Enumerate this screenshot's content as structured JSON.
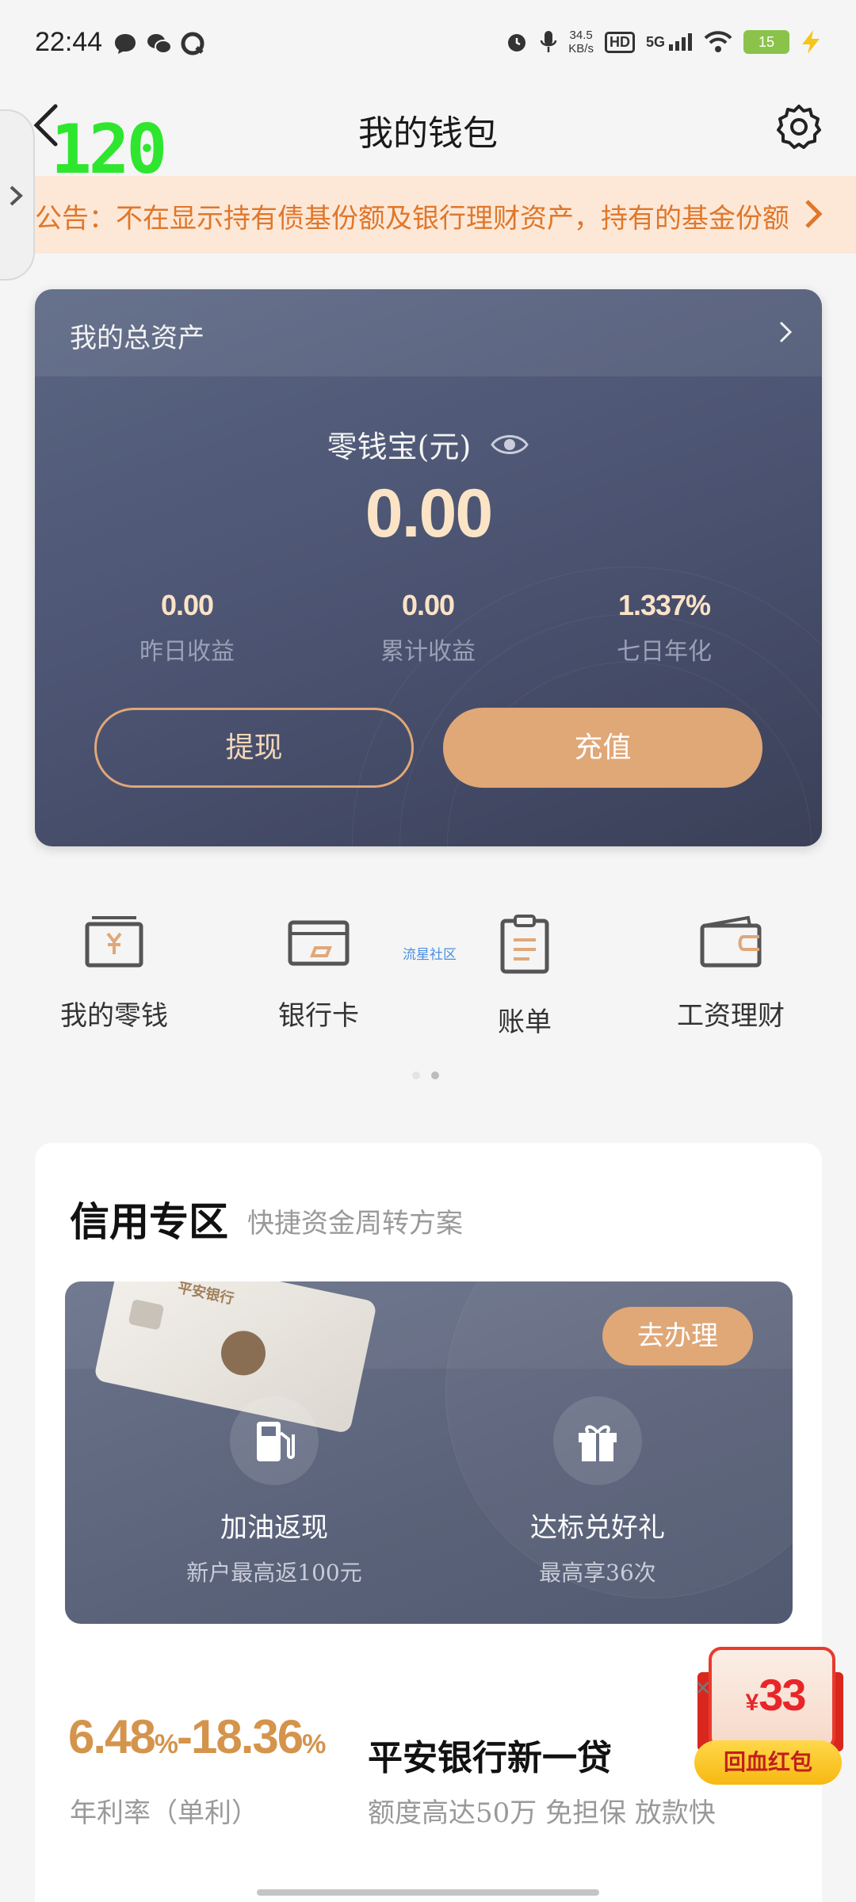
{
  "status_bar": {
    "time": "22:44",
    "net_speed_value": "34.5",
    "net_speed_unit": "KB/s",
    "hd_label": "HD",
    "network_label": "5G",
    "battery_level": "15"
  },
  "header": {
    "title": "我的钱包",
    "fps_counter": "120"
  },
  "notice": {
    "text": "公告：不在显示持有债基份额及银行理财资产，持有的基金份额:"
  },
  "assets": {
    "title": "我的总资产",
    "balance_label": "零钱宝(元)",
    "balance_value": "0.00",
    "stats": [
      {
        "value": "0.00",
        "label": "昨日收益"
      },
      {
        "value": "0.00",
        "label": "累计收益"
      },
      {
        "value": "1.337%",
        "label": "七日年化"
      }
    ],
    "withdraw_label": "提现",
    "recharge_label": "充值"
  },
  "shortcuts": {
    "items": [
      {
        "label": "我的零钱",
        "icon": "yuan-wallet-icon"
      },
      {
        "label": "银行卡",
        "icon": "bank-card-icon"
      },
      {
        "label": "账单",
        "icon": "bill-clipboard-icon"
      },
      {
        "label": "工资理财",
        "icon": "wallet-icon"
      }
    ],
    "community_tag": "流星社区"
  },
  "credit": {
    "title": "信用专区",
    "subtitle": "快捷资金周转方案",
    "go_button": "去办理",
    "promo_items": [
      {
        "title": "加油返现",
        "subtitle": "新户最高返100元",
        "icon": "fuel-pump-icon"
      },
      {
        "title": "达标兑好礼",
        "subtitle": "最高享36次",
        "icon": "gift-icon"
      }
    ],
    "loan": {
      "rate_low": "6.48",
      "rate_high": "18.36",
      "rate_unit": "%",
      "rate_label": "年利率（单利）",
      "name": "平安银行新一贷",
      "description": "额度高达50万  免担保  放款快"
    }
  },
  "red_packet": {
    "currency": "¥",
    "amount": "33",
    "label": "回血红包"
  },
  "colors": {
    "accent_gold": "#e0a777",
    "notice_text": "#e0772a",
    "card_bg": "#4a5270",
    "fps_green": "#2ee62e"
  }
}
